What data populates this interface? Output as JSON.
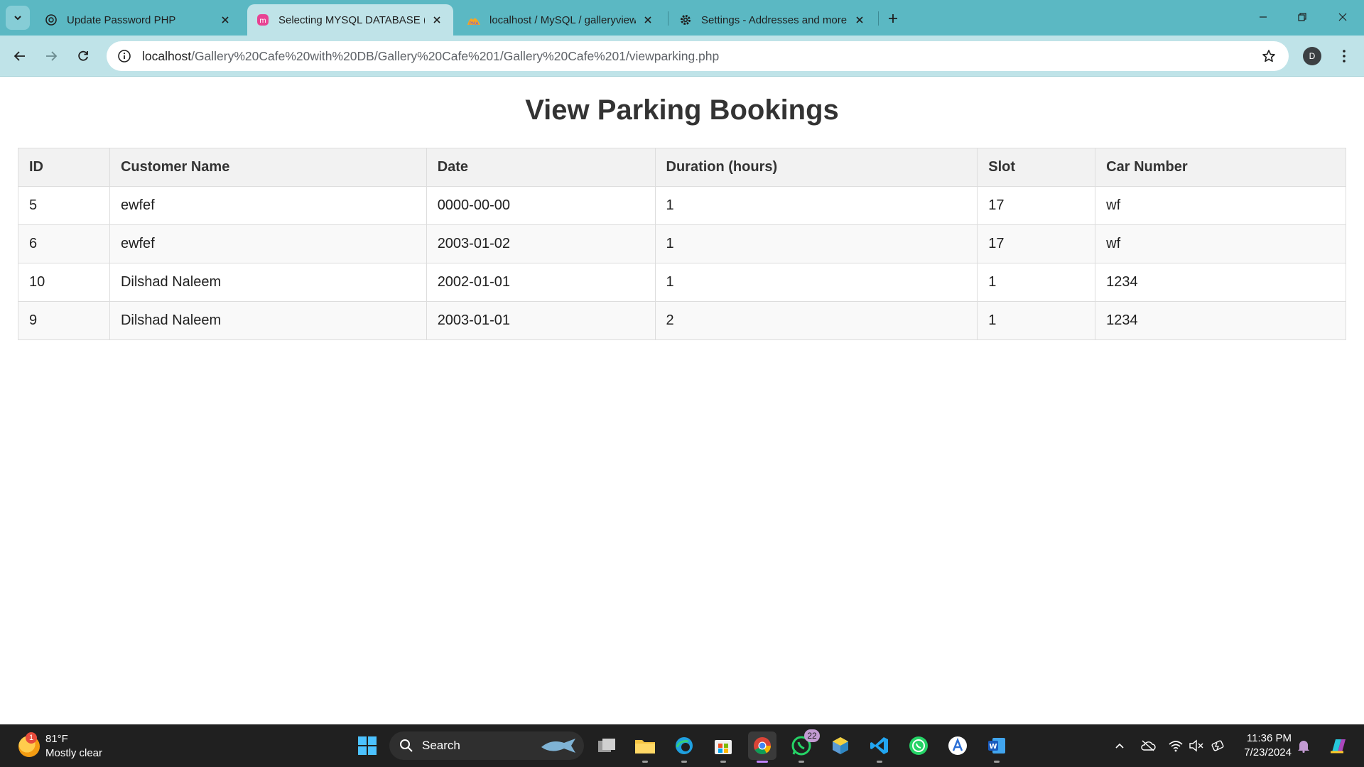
{
  "browser": {
    "tabs": [
      {
        "title": "Update Password PHP",
        "icon": "chatgpt-icon",
        "active": false
      },
      {
        "title": "Selecting MYSQL DATABASE (G",
        "icon": "app-icon",
        "active": true
      },
      {
        "title": "localhost / MySQL / galleryview",
        "icon": "phpmyadmin-icon",
        "active": false
      },
      {
        "title": "Settings - Addresses and more",
        "icon": "gear-icon",
        "active": false
      }
    ],
    "address": {
      "host": "localhost",
      "path": "/Gallery%20Cafe%20with%20DB/Gallery%20Cafe%201/Gallery%20Cafe%201/viewparking.php"
    },
    "profile_initial": "D"
  },
  "page": {
    "title": "View Parking Bookings",
    "columns": [
      "ID",
      "Customer Name",
      "Date",
      "Duration (hours)",
      "Slot",
      "Car Number"
    ],
    "rows": [
      [
        "5",
        "ewfef",
        "0000-00-00",
        "1",
        "17",
        "wf"
      ],
      [
        "6",
        "ewfef",
        "2003-01-02",
        "1",
        "17",
        "wf"
      ],
      [
        "10",
        "Dilshad Naleem",
        "2002-01-01",
        "1",
        "1",
        "1234"
      ],
      [
        "9",
        "Dilshad Naleem",
        "2003-01-01",
        "2",
        "1",
        "1234"
      ]
    ]
  },
  "taskbar": {
    "weather": {
      "badge": "1",
      "temp": "81°F",
      "condition": "Mostly clear"
    },
    "search_label": "Search",
    "whatsapp_badge": "22",
    "time": "11:36 PM",
    "date": "7/23/2024"
  },
  "colors": {
    "tabstrip": "#5bb8c3",
    "toolbar": "#bfe3e8",
    "header_bg": "#f2f2f2",
    "taskbar": "#202020"
  }
}
